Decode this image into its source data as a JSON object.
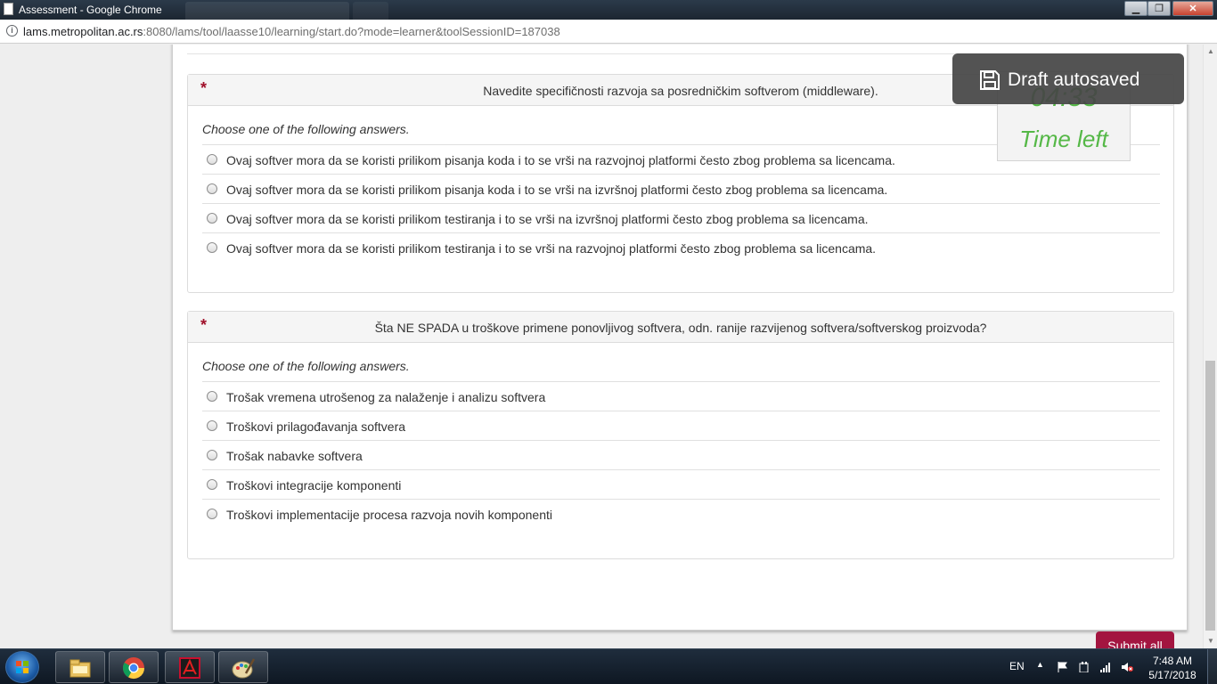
{
  "browser": {
    "window_title": "Assessment - Google Chrome",
    "url_host": "lams.metropolitan.ac.rs",
    "url_rest": ":8080/lams/tool/laasse10/learning/start.do?mode=learner&toolSessionID=187038"
  },
  "toast": {
    "text": "Draft autosaved",
    "icon": "save-icon"
  },
  "timer": {
    "countdown": "04:33",
    "label": "Time left",
    "color": "#55b847"
  },
  "questions": [
    {
      "required_mark": "*",
      "text": "Navedite specifičnosti razvoja sa posredničkim softverom (middleware).",
      "instruction": "Choose one of the following answers.",
      "answers": [
        "Ovaj softver mora da se koristi prilikom pisanja koda i to se vrši na razvojnoj platformi često zbog problema sa licencama.",
        "Ovaj softver mora da se koristi prilikom pisanja koda i to se vrši na izvršnoj platformi često zbog problema sa licencama.",
        "Ovaj softver mora da se koristi prilikom testiranja i to se vrši na izvršnoj platformi često zbog problema sa licencama.",
        "Ovaj softver mora da se koristi prilikom testiranja i to se vrši na razvojnoj platformi često zbog problema sa licencama."
      ]
    },
    {
      "required_mark": "*",
      "text": "Šta NE SPADA u troškove primene ponovljivog softvera, odn. ranije razvijenog softvera/softverskog proizvoda?",
      "instruction": "Choose one of the following answers.",
      "answers": [
        "Trošak vremena utrošenog za nalaženje i analizu softvera",
        "Troškovi prilagođavanja softvera",
        "Trošak nabavke softvera",
        "Troškovi integracije komponenti",
        "Troškovi implementacije procesa razvoja novih komponenti"
      ]
    }
  ],
  "submit": {
    "label": "Submit all",
    "color": "#a31540"
  },
  "taskbar": {
    "language": "EN",
    "time": "7:48 AM",
    "date": "5/17/2018",
    "apps": [
      "explorer-icon",
      "chrome-icon",
      "acrobat-icon",
      "paint-icon"
    ]
  }
}
